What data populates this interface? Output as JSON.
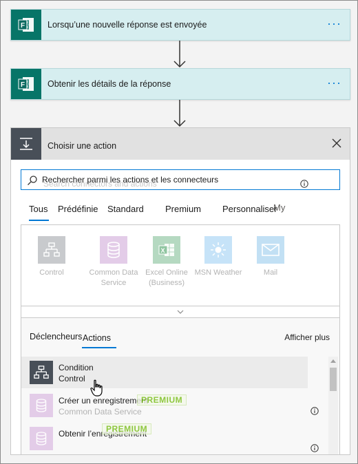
{
  "flow": {
    "trigger_title": "Lorsqu’une nouvelle réponse est envoyée",
    "step2_title": "Obtenir les détails de la réponse",
    "more_glyph": "···",
    "colors": {
      "forms_green": "#077568",
      "card_bg": "#d6eef0",
      "accent": "#0078d4"
    }
  },
  "action_panel": {
    "title": "Choisir une action",
    "search_value": "Rechercher parmi les actions et les connecteurs",
    "search_ghost": "Search connectors and actions",
    "tabs": [
      {
        "label": "Tous",
        "selected": true
      },
      {
        "label": "Prédéfinie"
      },
      {
        "label": "Standard"
      },
      {
        "label": "Premium"
      },
      {
        "label": "Personnaliser"
      }
    ],
    "tab_ghost": "My",
    "connectors": [
      {
        "label": "Control",
        "icon": "control-icon",
        "color": "#c8cacd"
      },
      {
        "label": "Common Data Service",
        "icon": "database-icon",
        "color": "#e3cce8"
      },
      {
        "label": "Excel Online (Business)",
        "icon": "excel-icon",
        "color": "#b5d9c1"
      },
      {
        "label": "MSN Weather",
        "icon": "sun-icon",
        "color": "#c6e3f8"
      },
      {
        "label": "Mail",
        "icon": "mail-icon",
        "color": "#c2e0f4"
      }
    ],
    "subtabs": {
      "triggers": "Déclencheurs",
      "actions": "Actions",
      "show_more": "Afficher plus"
    },
    "results": [
      {
        "title": "Condition",
        "subtitle": "Control",
        "icon": "control-icon",
        "icon_color": "#484f58",
        "premium": false
      },
      {
        "title": "Créer un enregistrement",
        "subtitle": "Common Data Service",
        "icon": "database-icon",
        "icon_color": "#e3cce8",
        "premium": true
      },
      {
        "title": "Obtenir l’enregistrement",
        "subtitle": "",
        "icon": "database-icon",
        "icon_color": "#e3cce8",
        "premium": true
      }
    ],
    "premium_label": "PREMIUM"
  }
}
